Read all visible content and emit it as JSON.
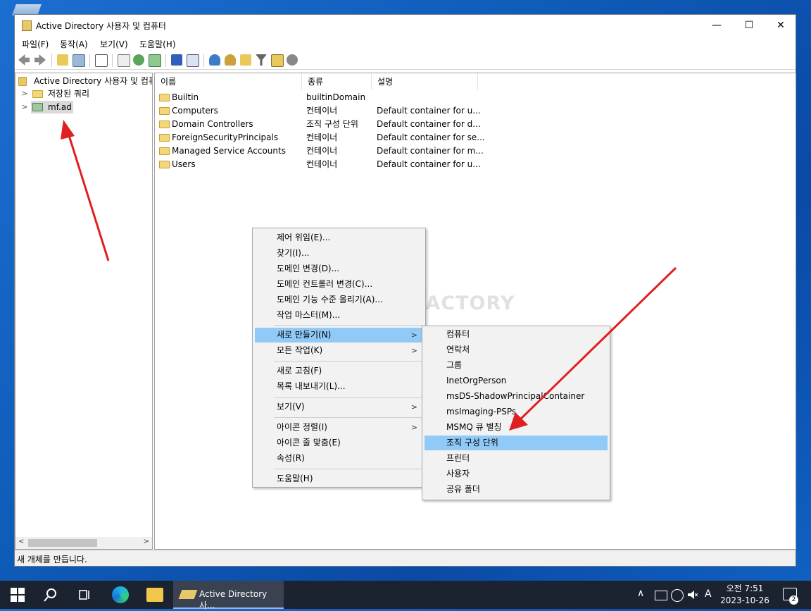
{
  "window": {
    "title": "Active Directory 사용자 및 컴퓨터",
    "minimize": "—",
    "maximize": "☐",
    "close": "✕"
  },
  "menubar": [
    "파일(F)",
    "동작(A)",
    "보기(V)",
    "도움말(H)"
  ],
  "tree": {
    "root": "Active Directory 사용자 및 컴퓨",
    "items": [
      "저장된 쿼리",
      "mf.ad"
    ]
  },
  "list": {
    "columns": [
      "이름",
      "종류",
      "설명"
    ],
    "rows": [
      {
        "name": "Builtin",
        "type": "builtinDomain",
        "desc": ""
      },
      {
        "name": "Computers",
        "type": "컨테이너",
        "desc": "Default container for u..."
      },
      {
        "name": "Domain Controllers",
        "type": "조직 구성 단위",
        "desc": "Default container for d..."
      },
      {
        "name": "ForeignSecurityPrincipals",
        "type": "컨테이너",
        "desc": "Default container for se..."
      },
      {
        "name": "Managed Service Accounts",
        "type": "컨테이너",
        "desc": "Default container for m..."
      },
      {
        "name": "Users",
        "type": "컨테이너",
        "desc": "Default container for u..."
      }
    ]
  },
  "context_menu": [
    "제어 위임(E)...",
    "찾기(I)...",
    "도메인 변경(D)...",
    "도메인 컨트롤러 변경(C)...",
    "도메인 기능 수준 올리기(A)...",
    "작업 마스터(M)...",
    "새로 만들기(N)",
    "모든 작업(K)",
    "새로 고침(F)",
    "목록 내보내기(L)...",
    "보기(V)",
    "아이콘 정렬(I)",
    "아이콘 줄 맞춤(E)",
    "속성(R)",
    "도움말(H)"
  ],
  "submenu": [
    "컴퓨터",
    "연락처",
    "그룹",
    "InetOrgPerson",
    "msDS-ShadowPrincipalContainer",
    "msImaging-PSPs",
    "MSMQ 큐 별칭",
    "조직 구성 단위",
    "프린터",
    "사용자",
    "공유 폴더"
  ],
  "watermark": "ANUAL FACTORY",
  "status": "새 개체를 만듭니다.",
  "taskbar": {
    "app_label": "Active Directory 사...",
    "ime": "A",
    "time": "오전 7:51",
    "date": "2023-10-26",
    "notifications": "2"
  },
  "colors": {
    "highlight": "#91c9f7",
    "arrow": "#e02020",
    "taskbar": "#1c2330"
  }
}
